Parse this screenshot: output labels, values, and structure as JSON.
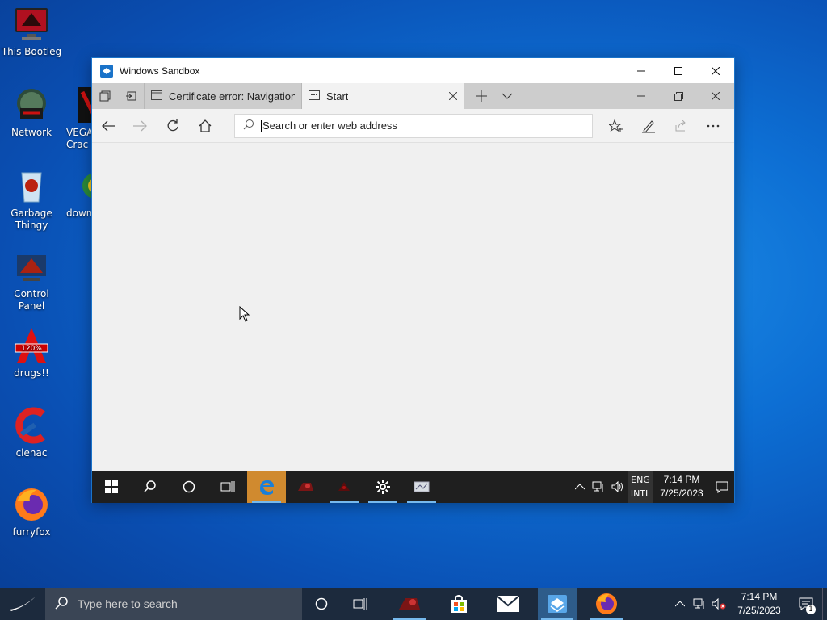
{
  "desktop": {
    "icons": [
      {
        "label": "This Bootleg"
      },
      {
        "label": "Network"
      },
      {
        "label": "Garbage Thingy"
      },
      {
        "label": "Control Panel"
      },
      {
        "label": "drugs!!"
      },
      {
        "label": "clenac"
      },
      {
        "label": "furryfox"
      },
      {
        "label": "VEGA Crac"
      },
      {
        "label": "down th"
      }
    ]
  },
  "sandbox": {
    "title": "Windows Sandbox",
    "tabs": [
      {
        "label": "Certificate error: Navigation"
      },
      {
        "label": "Start"
      }
    ],
    "address_placeholder": "Search or enter web address",
    "taskbar": {
      "lang_top": "ENG",
      "lang_bottom": "INTL",
      "time": "7:14 PM",
      "date": "7/25/2023"
    }
  },
  "taskbar": {
    "search_placeholder": "Type here to search",
    "time": "7:14 PM",
    "date": "7/25/2023",
    "notification_count": "1"
  },
  "colors": {
    "edge_highlight": "#d08a2f",
    "taskbar": "#1c2a3d",
    "underline": "#76b9ed"
  }
}
